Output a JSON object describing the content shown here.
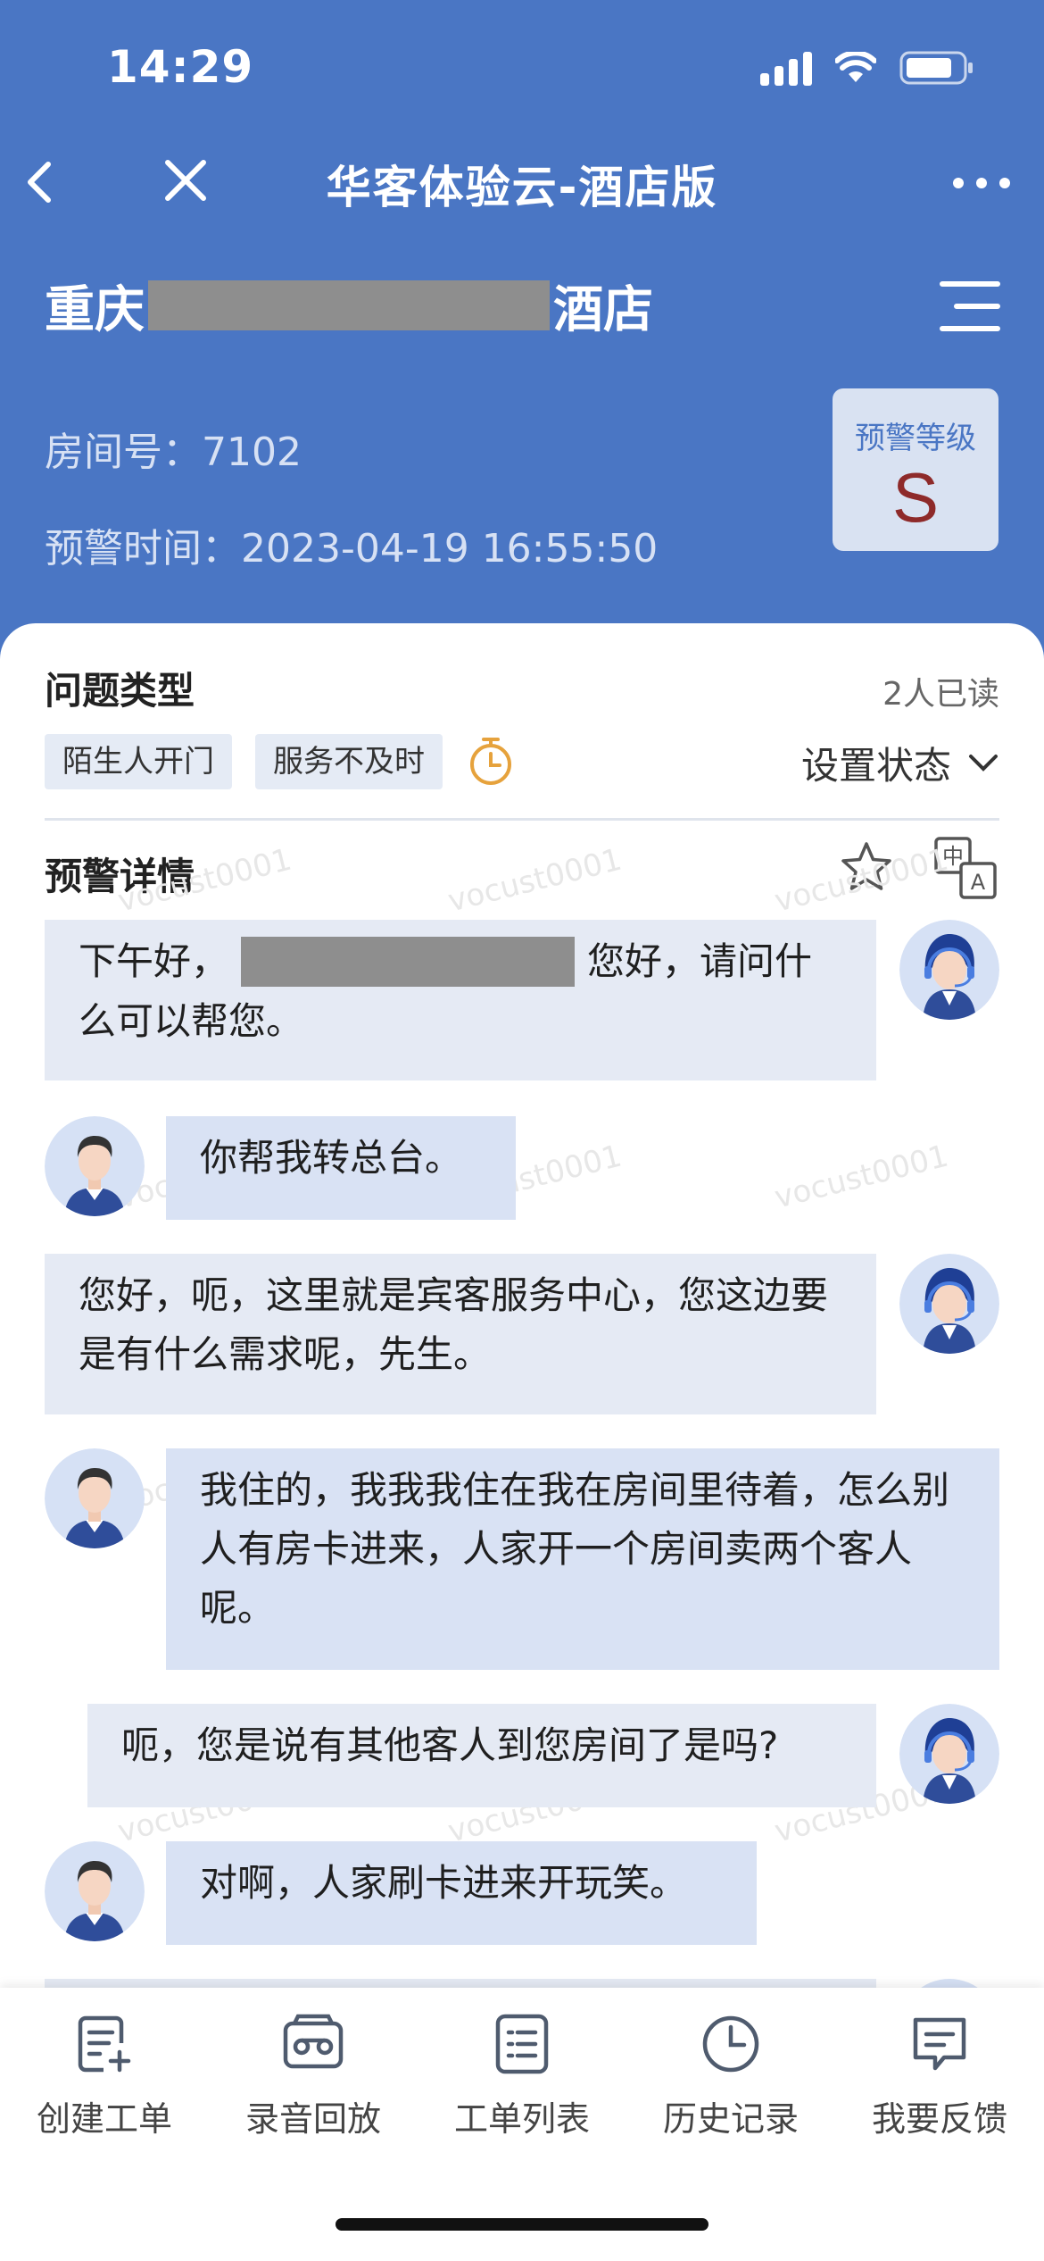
{
  "status_bar": {
    "time": "14:29"
  },
  "nav": {
    "title": "华客体验云-酒店版"
  },
  "header": {
    "hotel_name_prefix": "重庆",
    "hotel_name_suffix": "酒店",
    "room": "房间号：7102",
    "alert_time": "预警时间：2023-04-19 16:55:50",
    "level_label": "预警等级",
    "level_value": "S"
  },
  "issue": {
    "title": "问题类型",
    "read_count": "2人已读",
    "tags": [
      "陌生人开门",
      "服务不及时"
    ],
    "set_status": "设置状态"
  },
  "details": {
    "title": "预警详情",
    "watermark": "vocust0001",
    "messages": [
      {
        "speaker": "agent",
        "text_before": "下午好，",
        "text_after": "您好，请问什么可以帮您。"
      },
      {
        "speaker": "user",
        "text": "你帮我转总台。"
      },
      {
        "speaker": "agent",
        "text": "您好，呃，这里就是宾客服务中心，您这边要是有什么需求呢，先生。"
      },
      {
        "speaker": "user",
        "text": "我住的，我我我住在我在房间里待着，怎么别人有房卡进来，人家开一个房间卖两个客人呢。"
      },
      {
        "speaker": "agent",
        "text": "呃，您是说有其他客人到您房间了是吗?"
      },
      {
        "speaker": "user",
        "text": "对啊，人家刷卡进来开玩笑。"
      }
    ]
  },
  "bottom_tabs": [
    {
      "label": "创建工单",
      "icon": "create-ticket-icon"
    },
    {
      "label": "录音回放",
      "icon": "recording-icon"
    },
    {
      "label": "工单列表",
      "icon": "list-icon"
    },
    {
      "label": "历史记录",
      "icon": "clock-icon"
    },
    {
      "label": "我要反馈",
      "icon": "feedback-icon"
    }
  ],
  "colors": {
    "primary": "#4a76c4",
    "level": "#8e2a2a",
    "bubble_agent": "#e5eaf4",
    "bubble_user": "#d9e2f4"
  }
}
